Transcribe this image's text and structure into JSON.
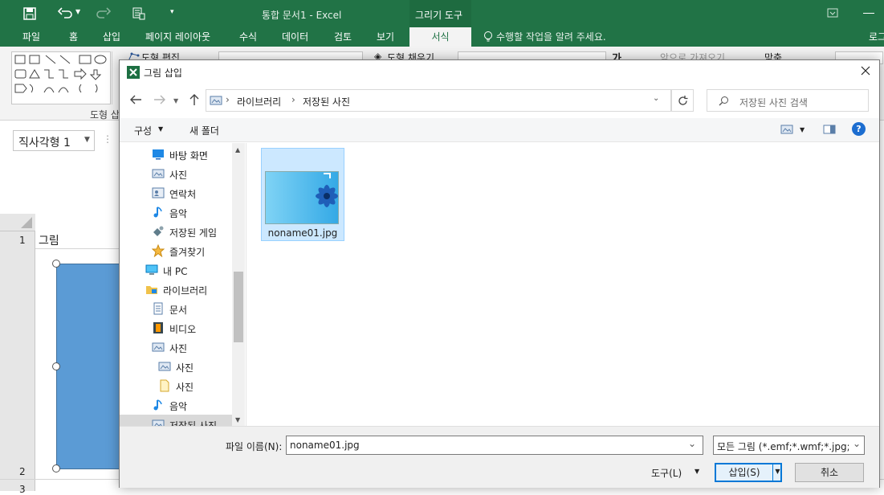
{
  "excel": {
    "window_title": "통합 문서1 - Excel",
    "tool_context": "그리기 도구",
    "tabs": [
      "파일",
      "홈",
      "삽입",
      "페이지 레이아웃",
      "수식",
      "데이터",
      "검토",
      "보기",
      "서식"
    ],
    "tell_me": "수행할 작업을 알려 주세요.",
    "signin": "로그",
    "ribbon": {
      "edit_shape": "도형 편집",
      "shape_fill": "도형 채우기",
      "bring_forward": "앞으로 가져오기",
      "align": "맞춤",
      "insert_shapes_group": "도형 삽"
    },
    "name_box": "직사각형 1",
    "cell_text": "그림",
    "rows": [
      "1",
      "2",
      "3"
    ]
  },
  "dialog": {
    "title": "그림 삽입",
    "breadcrumb": [
      "라이브러리",
      "저장된 사진"
    ],
    "search_placeholder": "저장된 사진 검색",
    "organize": "구성",
    "new_folder": "새 폴더",
    "nav_items": [
      {
        "label": "바탕 화면",
        "icon": "desktop-icon"
      },
      {
        "label": "사진",
        "icon": "pictures-icon"
      },
      {
        "label": "연락처",
        "icon": "contacts-icon"
      },
      {
        "label": "음악",
        "icon": "music-icon"
      },
      {
        "label": "저장된 게임",
        "icon": "saved-games-icon"
      },
      {
        "label": "즐겨찾기",
        "icon": "favorites-icon"
      },
      {
        "label": "내 PC",
        "icon": "this-pc-icon"
      },
      {
        "label": "라이브러리",
        "icon": "libraries-icon"
      },
      {
        "label": "문서",
        "icon": "documents-icon"
      },
      {
        "label": "비디오",
        "icon": "videos-icon"
      },
      {
        "label": "사진",
        "icon": "pictures-icon"
      },
      {
        "label": "사진",
        "icon": "pictures-icon"
      },
      {
        "label": "사진",
        "icon": "folder-icon"
      },
      {
        "label": "음악",
        "icon": "music-icon"
      },
      {
        "label": "저장된 사진",
        "icon": "pictures-icon"
      }
    ],
    "file": {
      "name": "noname01.jpg"
    },
    "filename_label": "파일 이름(N):",
    "filename_value": "noname01.jpg",
    "filetype": "모든 그림 (*.emf;*.wmf;*.jpg;*.",
    "tools": "도구(L)",
    "insert": "삽입(S)",
    "cancel": "취소"
  }
}
